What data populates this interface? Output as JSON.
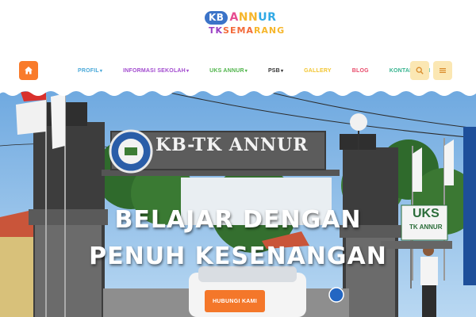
{
  "logo": {
    "badge": "KB",
    "line1_a": "A",
    "line1_b": "NN",
    "line1_c": "UR",
    "line2_a": "TK",
    "line2_b": "SEMA",
    "line2_c": "RANG"
  },
  "nav": {
    "items": [
      {
        "label": "PROFIL",
        "has_caret": true
      },
      {
        "label": "INFORMASI SEKOLAH",
        "has_caret": true
      },
      {
        "label": "UKS ANNUR",
        "has_caret": true
      },
      {
        "label": "PSB",
        "has_caret": true
      },
      {
        "label": "GALLERY",
        "has_caret": false
      },
      {
        "label": "BLOG",
        "has_caret": false
      },
      {
        "label": "KONTAK KAMI",
        "has_caret": false
      }
    ],
    "caret": "▾",
    "home_icon": "home-icon",
    "search_icon": "search-icon",
    "menu_icon": "hamburger-menu-icon"
  },
  "hero": {
    "gate_sign": "KB-TK ANNUR",
    "uks_sign_title": "UKS",
    "uks_sign_sub": "TK ANNUR",
    "title_line1": "BELAJAR DENGAN",
    "title_line2": "PENUH KESENANGAN",
    "cta_label": "HUBUNGI KAMI"
  },
  "colors": {
    "accent": "#f97b2b",
    "nav_button_bg": "#fbe7b3"
  }
}
